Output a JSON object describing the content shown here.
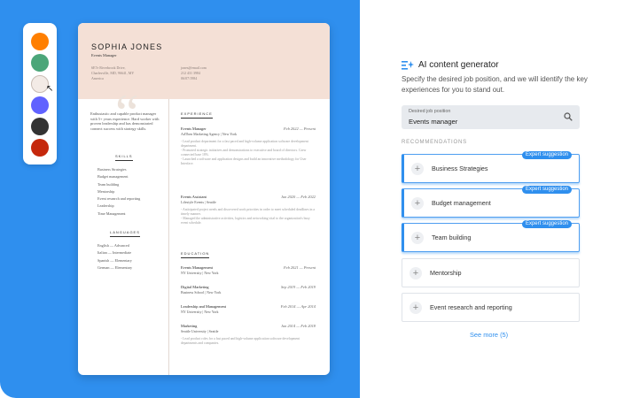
{
  "palette": {
    "colors": [
      "#ff7f00",
      "#4ca679",
      "#f3ebe6",
      "#6062ff",
      "#333333",
      "#c5280c"
    ],
    "selected": 2
  },
  "resume": {
    "name": "SOPHIA JONES",
    "role": "Events Manager",
    "contact_left": "6E7e Riverbrook Drive,\nCharlesville, MD, 96641, MY\nAmerica",
    "contact_right": "jones@email.com\n212 431 3984\n06/07/1984",
    "summary": "Enthusiastic and capable product manager with 5+ years experience. Hard worker with proven leadership and has demonstrated connect success with strategy skills.",
    "skills_heading": "SKILLS",
    "skills": [
      "Business Strategies",
      "Budget management",
      "Team building",
      "Mentorship",
      "Event research and reporting",
      "Leadership",
      "Time Management"
    ],
    "languages_heading": "LANGUAGES",
    "languages": [
      "English — Advanced",
      "Italian — Intermediate",
      "Spanish — Elementary",
      "German — Elementary"
    ],
    "experience_heading": "EXPERIENCE",
    "experience": [
      {
        "title": "Events Manager",
        "date": "Feb 2022 — Present",
        "org": "AdThen Marketing Agency | New York",
        "desc": "- Lead product department for a fast paced and high-volume application software development department.\n- Promoted strategic initiatives and demonstrations to executive and board of directors. Grew connected base 18%.\n- Launched a software and application designs and build an innovative methodology for User Interface."
      },
      {
        "title": "Events Assistant",
        "date": "Jun 2020 — Feb 2022",
        "org": "Lifestyle Events | Seattle",
        "desc": "- Anticipated project needs and discovered work priorities in order to meet scheduled deadlines in a timely manner.\n- Managed the administrative activities, logistics and networking vital to the organization's busy event schedule."
      }
    ],
    "education_heading": "EDUCATION",
    "education": [
      {
        "title": "Events Management",
        "date": "Feb 2021 — Present",
        "org": "NY University | New York",
        "desc": ""
      },
      {
        "title": "Digital Marketing",
        "date": "Sep 2019 — Feb 2019",
        "org": "Business School | New York",
        "desc": ""
      },
      {
        "title": "Leadership and Management",
        "date": "Feb 2014 — Apr 2014",
        "org": "NY University | New York",
        "desc": ""
      },
      {
        "title": "Marketing",
        "date": "Jun 2014 — Feb 2018",
        "org": "Seattle University | Seattle",
        "desc": "- Lead product roles for a fast paced and high-volume application software development departments and companies."
      }
    ]
  },
  "ai": {
    "title": "AI content generator",
    "description": "Specify the desired job position, and we will identify the key experiences for you to stand out.",
    "search_label": "Desired job position",
    "search_value": "Events manager",
    "recommendations_heading": "RECOMMENDATIONS",
    "badge_text": "Expert suggestion",
    "recommendations": [
      {
        "label": "Business Strategies",
        "expert": true
      },
      {
        "label": "Budget management",
        "expert": true
      },
      {
        "label": "Team building",
        "expert": true
      },
      {
        "label": "Mentorship",
        "expert": false
      },
      {
        "label": "Event research and reporting",
        "expert": false
      }
    ],
    "see_more": "See more (5)",
    "accent": "#2f8fee"
  }
}
